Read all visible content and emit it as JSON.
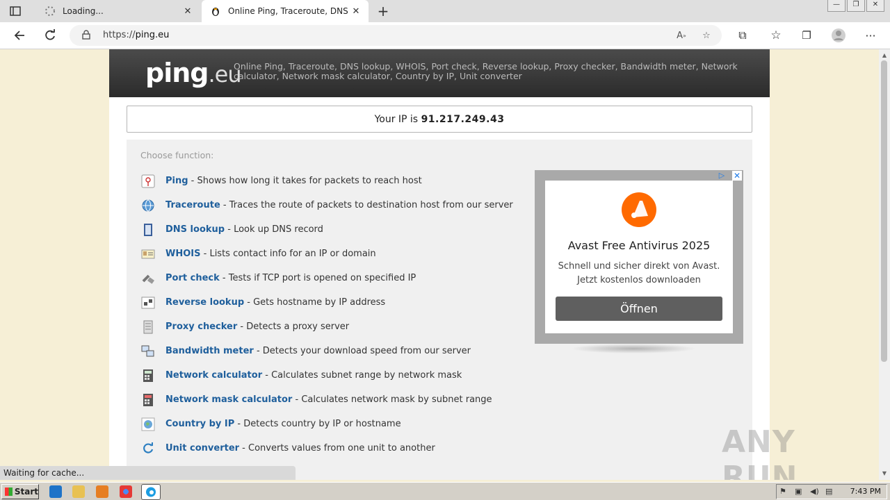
{
  "browser": {
    "tabs": [
      {
        "title": "Loading...",
        "close": "✕"
      },
      {
        "title": "Online Ping, Traceroute, DNS lo",
        "close": "✕"
      }
    ],
    "new_tab": "+",
    "address": {
      "scheme": "https://",
      "host": "ping.eu"
    },
    "window_controls": [
      "—",
      "❐",
      "✕"
    ]
  },
  "site": {
    "logo_main": "ping",
    "logo_tld": ".eu",
    "tagline": "Online Ping, Traceroute, DNS lookup, WHOIS, Port check, Reverse lookup, Proxy checker, Bandwidth meter, Network calculator, Network mask calculator, Country by IP, Unit converter",
    "ip_label": "Your IP is",
    "ip_value": "91.217.249.43",
    "choose_label": "Choose function:",
    "functions": [
      {
        "name": "Ping",
        "desc": "Shows how long it takes for packets to reach host",
        "icon": "ping-icon"
      },
      {
        "name": "Traceroute",
        "desc": "Traces the route of packets to destination host from our server",
        "icon": "globe-icon"
      },
      {
        "name": "DNS lookup",
        "desc": "Look up DNS record",
        "icon": "book-icon"
      },
      {
        "name": "WHOIS",
        "desc": "Lists contact info for an IP or domain",
        "icon": "id-card-icon"
      },
      {
        "name": "Port check",
        "desc": "Tests if TCP port is opened on specified IP",
        "icon": "plug-icon"
      },
      {
        "name": "Reverse lookup",
        "desc": "Gets hostname by IP address",
        "icon": "network-icon"
      },
      {
        "name": "Proxy checker",
        "desc": "Detects a proxy server",
        "icon": "server-icon"
      },
      {
        "name": "Bandwidth meter",
        "desc": "Detects your download speed from our server",
        "icon": "computers-icon"
      },
      {
        "name": "Network calculator",
        "desc": "Calculates subnet range by network mask",
        "icon": "calculator-icon"
      },
      {
        "name": "Network mask calculator",
        "desc": "Calculates network mask by subnet range",
        "icon": "calculator-red-icon"
      },
      {
        "name": "Country by IP",
        "desc": "Detects country by IP or hostname",
        "icon": "earth-icon"
      },
      {
        "name": "Unit converter",
        "desc": "Converts values from one unit to another",
        "icon": "refresh-icon"
      }
    ]
  },
  "ad": {
    "title": "Avast Free Antivirus 2025",
    "text": "Schnell und sicher direkt von Avast. Jetzt kostenlos downloaden",
    "button": "Öffnen",
    "adchoices": "▷",
    "close": "✕"
  },
  "watermark": "ANY RUN",
  "status_text": "Waiting for cache...",
  "taskbar": {
    "start_label": "Start",
    "clock": "7:43 PM"
  }
}
